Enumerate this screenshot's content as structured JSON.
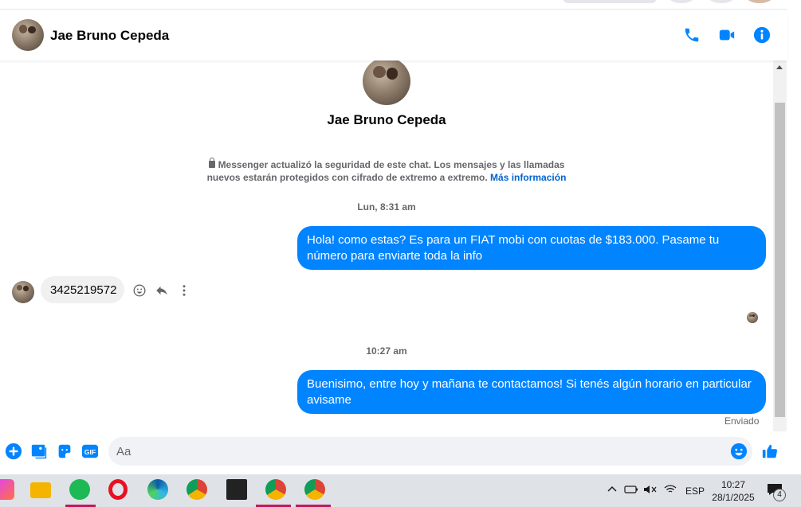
{
  "header": {
    "contact_name": "Jae Bruno Cepeda",
    "icons": [
      "phone-icon",
      "video-icon",
      "info-icon"
    ]
  },
  "profile": {
    "name": "Jae Bruno Cepeda"
  },
  "security_notice": {
    "text": "Messenger actualizó la seguridad de este chat. Los mensajes y las llamadas nuevos estarán protegidos con cifrado de extremo a extremo.",
    "link": "Más información"
  },
  "messages": [
    {
      "timestamp": "Lun, 8:31 am"
    },
    {
      "direction": "outgoing",
      "text": "Hola! como estas? Es para un FIAT mobi con cuotas de $183.000. Pasame tu número para enviarte toda la info"
    },
    {
      "direction": "incoming",
      "text": "3425219572"
    },
    {
      "timestamp": "10:27 am"
    },
    {
      "direction": "outgoing",
      "text": "Buenisimo, entre hoy y mañana te contactamos! Si tenés algún horario en particular avisame",
      "status": "Enviado"
    }
  ],
  "composer": {
    "placeholder": "Aa",
    "gif_label": "GIF"
  },
  "taskbar": {
    "language": "ESP",
    "time": "10:27",
    "date": "28/1/2025",
    "notifications": "4"
  },
  "colors": {
    "accent": "#0084ff",
    "bubble_in": "#f0f0f0",
    "link": "#0064d1"
  }
}
